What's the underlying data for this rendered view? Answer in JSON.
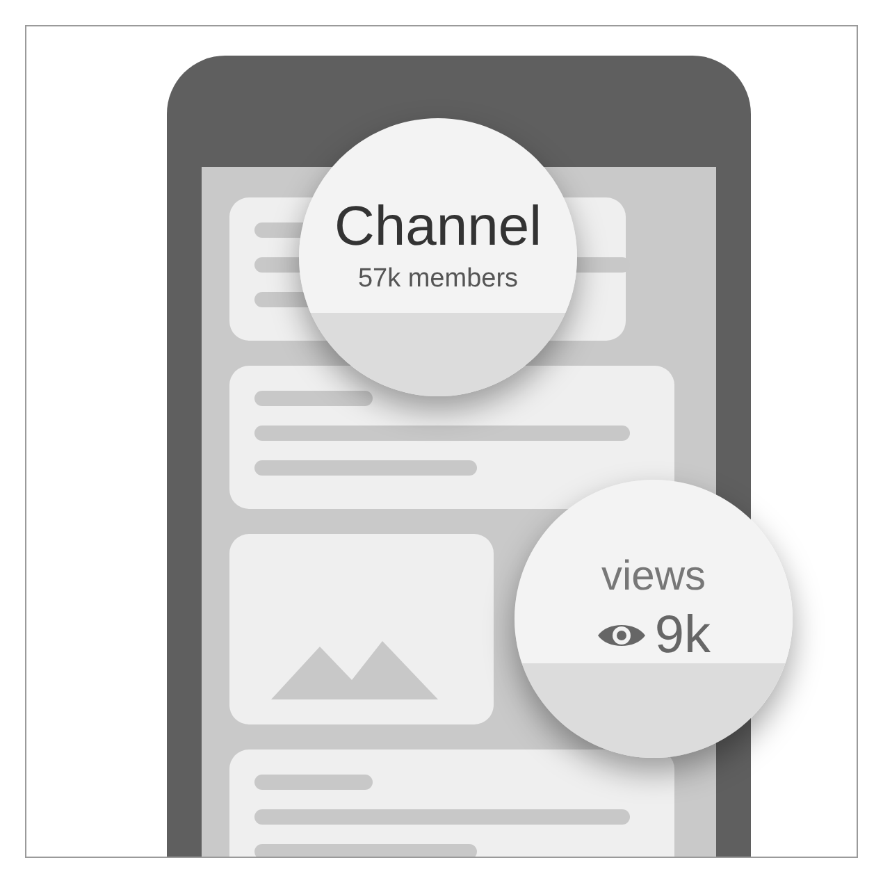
{
  "header": {
    "title": "Channel",
    "subtitle": "57k members"
  },
  "stats": {
    "label": "views",
    "count": "9k"
  },
  "feed": [
    {
      "kind": "text"
    },
    {
      "kind": "text"
    },
    {
      "kind": "picture"
    },
    {
      "kind": "text"
    }
  ]
}
